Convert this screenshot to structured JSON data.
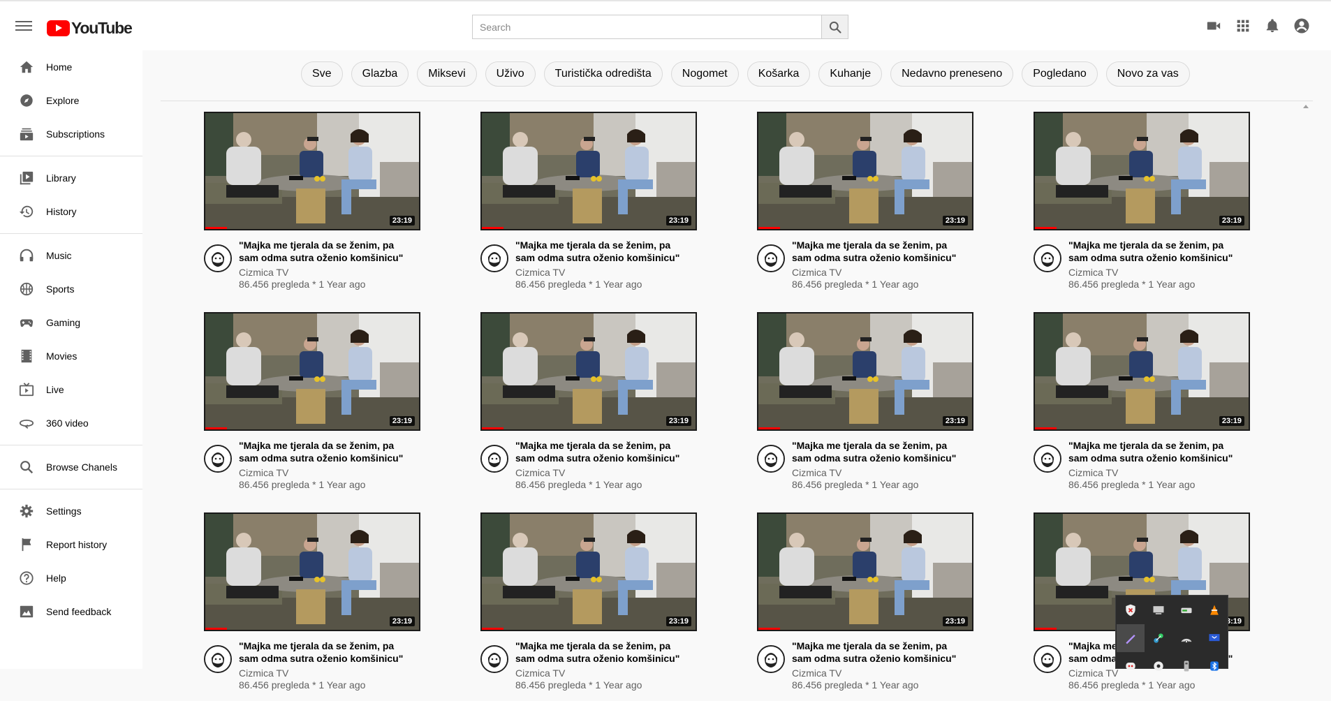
{
  "app": {
    "logo_text": "YouTube"
  },
  "search": {
    "placeholder": "Search"
  },
  "sidebar": {
    "groups": [
      [
        {
          "label": "Home",
          "icon": "home-icon"
        },
        {
          "label": "Explore",
          "icon": "compass-icon"
        },
        {
          "label": "Subscriptions",
          "icon": "subscriptions-icon"
        }
      ],
      [
        {
          "label": "Library",
          "icon": "library-icon"
        },
        {
          "label": "History",
          "icon": "history-icon"
        }
      ],
      [
        {
          "label": "Music",
          "icon": "headphones-icon"
        },
        {
          "label": "Sports",
          "icon": "trophy-icon"
        },
        {
          "label": "Gaming",
          "icon": "gamepad-icon"
        },
        {
          "label": "Movies",
          "icon": "film-icon"
        },
        {
          "label": "Live",
          "icon": "live-icon"
        },
        {
          "label": "360 video",
          "icon": "vr-icon"
        }
      ],
      [
        {
          "label": "Browse Chanels",
          "icon": "search-icon"
        }
      ],
      [
        {
          "label": "Settings",
          "icon": "gear-icon"
        },
        {
          "label": "Report history",
          "icon": "flag-icon"
        },
        {
          "label": "Help",
          "icon": "help-icon"
        },
        {
          "label": "Send feedback",
          "icon": "feedback-icon"
        }
      ]
    ]
  },
  "chips": [
    "Sve",
    "Glazba",
    "Miksevi",
    "Uživo",
    "Turistička odredišta",
    "Nogomet",
    "Košarka",
    "Kuhanje",
    "Nedavno preneseno",
    "Pogledano",
    "Novo za vas"
  ],
  "video": {
    "title": "\"Majka me tjerala da se ženim, pa sam odma sutra oženio komšinicu\"",
    "channel": "Cizmica TV",
    "stats": "86.456 pregleda * 1 Year ago",
    "duration": "23:19",
    "watched_fraction": 0.1
  },
  "colors": {
    "brand": "#ff0000",
    "text_secondary": "#606060"
  },
  "tray_icons": [
    "shield-icon",
    "monitor-icon",
    "drive-icon",
    "vlc-icon",
    "pen-icon",
    "network-icon",
    "wifi-icon",
    "display-icon",
    "discord-icon",
    "steam-icon",
    "usb-icon",
    "bluetooth-icon"
  ]
}
